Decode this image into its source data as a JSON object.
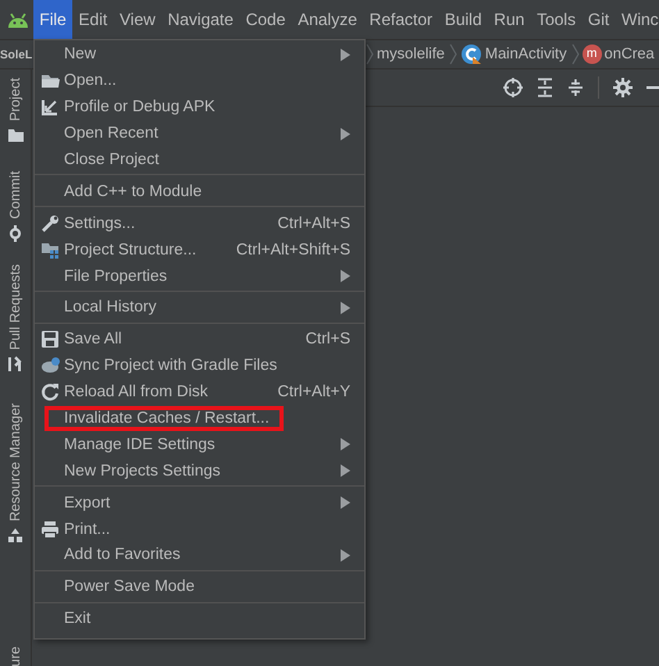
{
  "menubar": [
    {
      "label": "File",
      "selected": true
    },
    {
      "label": "Edit",
      "selected": false
    },
    {
      "label": "View",
      "selected": false
    },
    {
      "label": "Navigate",
      "selected": false
    },
    {
      "label": "Code",
      "selected": false
    },
    {
      "label": "Analyze",
      "selected": false
    },
    {
      "label": "Refactor",
      "selected": false
    },
    {
      "label": "Build",
      "selected": false
    },
    {
      "label": "Run",
      "selected": false
    },
    {
      "label": "Tools",
      "selected": false
    },
    {
      "label": "Git",
      "selected": false
    },
    {
      "label": "Winc",
      "selected": false
    }
  ],
  "project_name": "SoleL",
  "breadcrumbs": [
    {
      "label": "mysolelife",
      "kind": "folder"
    },
    {
      "label": "MainActivity",
      "kind": "class"
    },
    {
      "label": "onCrea",
      "kind": "method",
      "badge": "m"
    }
  ],
  "side_tabs": [
    {
      "label": "Project",
      "kind": "folder"
    },
    {
      "label": "Commit",
      "kind": "commit"
    },
    {
      "label": "Pull Requests",
      "kind": "pull"
    },
    {
      "label": "Resource Manager",
      "kind": "resources"
    },
    {
      "label": "ure",
      "kind": "plain"
    }
  ],
  "file_menu": [
    {
      "kind": "item",
      "label": "New",
      "submenu": true
    },
    {
      "kind": "folder",
      "label": "Open..."
    },
    {
      "kind": "arrow",
      "label": "Profile or Debug APK"
    },
    {
      "kind": "item",
      "label": "Open Recent",
      "submenu": true
    },
    {
      "kind": "item",
      "label": "Close Project"
    },
    {
      "kind": "separator"
    },
    {
      "kind": "item",
      "label": "Add C++ to Module"
    },
    {
      "kind": "separator"
    },
    {
      "kind": "wrench",
      "label": "Settings...",
      "shortcut": "Ctrl+Alt+S"
    },
    {
      "kind": "structure",
      "label": "Project Structure...",
      "shortcut": "Ctrl+Alt+Shift+S"
    },
    {
      "kind": "item",
      "label": "File Properties",
      "submenu": true
    },
    {
      "kind": "separator"
    },
    {
      "kind": "item",
      "label": "Local History",
      "submenu": true
    },
    {
      "kind": "separator"
    },
    {
      "kind": "save",
      "label": "Save All",
      "shortcut": "Ctrl+S"
    },
    {
      "kind": "sync",
      "label": "Sync Project with Gradle Files"
    },
    {
      "kind": "reload",
      "label": "Reload All from Disk",
      "shortcut": "Ctrl+Alt+Y"
    },
    {
      "kind": "item",
      "label": "Invalidate Caches / Restart...",
      "highlighted": true
    },
    {
      "kind": "item",
      "label": "Manage IDE Settings",
      "submenu": true
    },
    {
      "kind": "item",
      "label": "New Projects Settings",
      "submenu": true
    },
    {
      "kind": "separator"
    },
    {
      "kind": "item",
      "label": "Export",
      "submenu": true
    },
    {
      "kind": "print",
      "label": "Print..."
    },
    {
      "kind": "item",
      "label": "Add to Favorites",
      "submenu": true
    },
    {
      "kind": "separator"
    },
    {
      "kind": "item",
      "label": "Power Save Mode"
    },
    {
      "kind": "separator"
    },
    {
      "kind": "item",
      "label": "Exit"
    }
  ]
}
